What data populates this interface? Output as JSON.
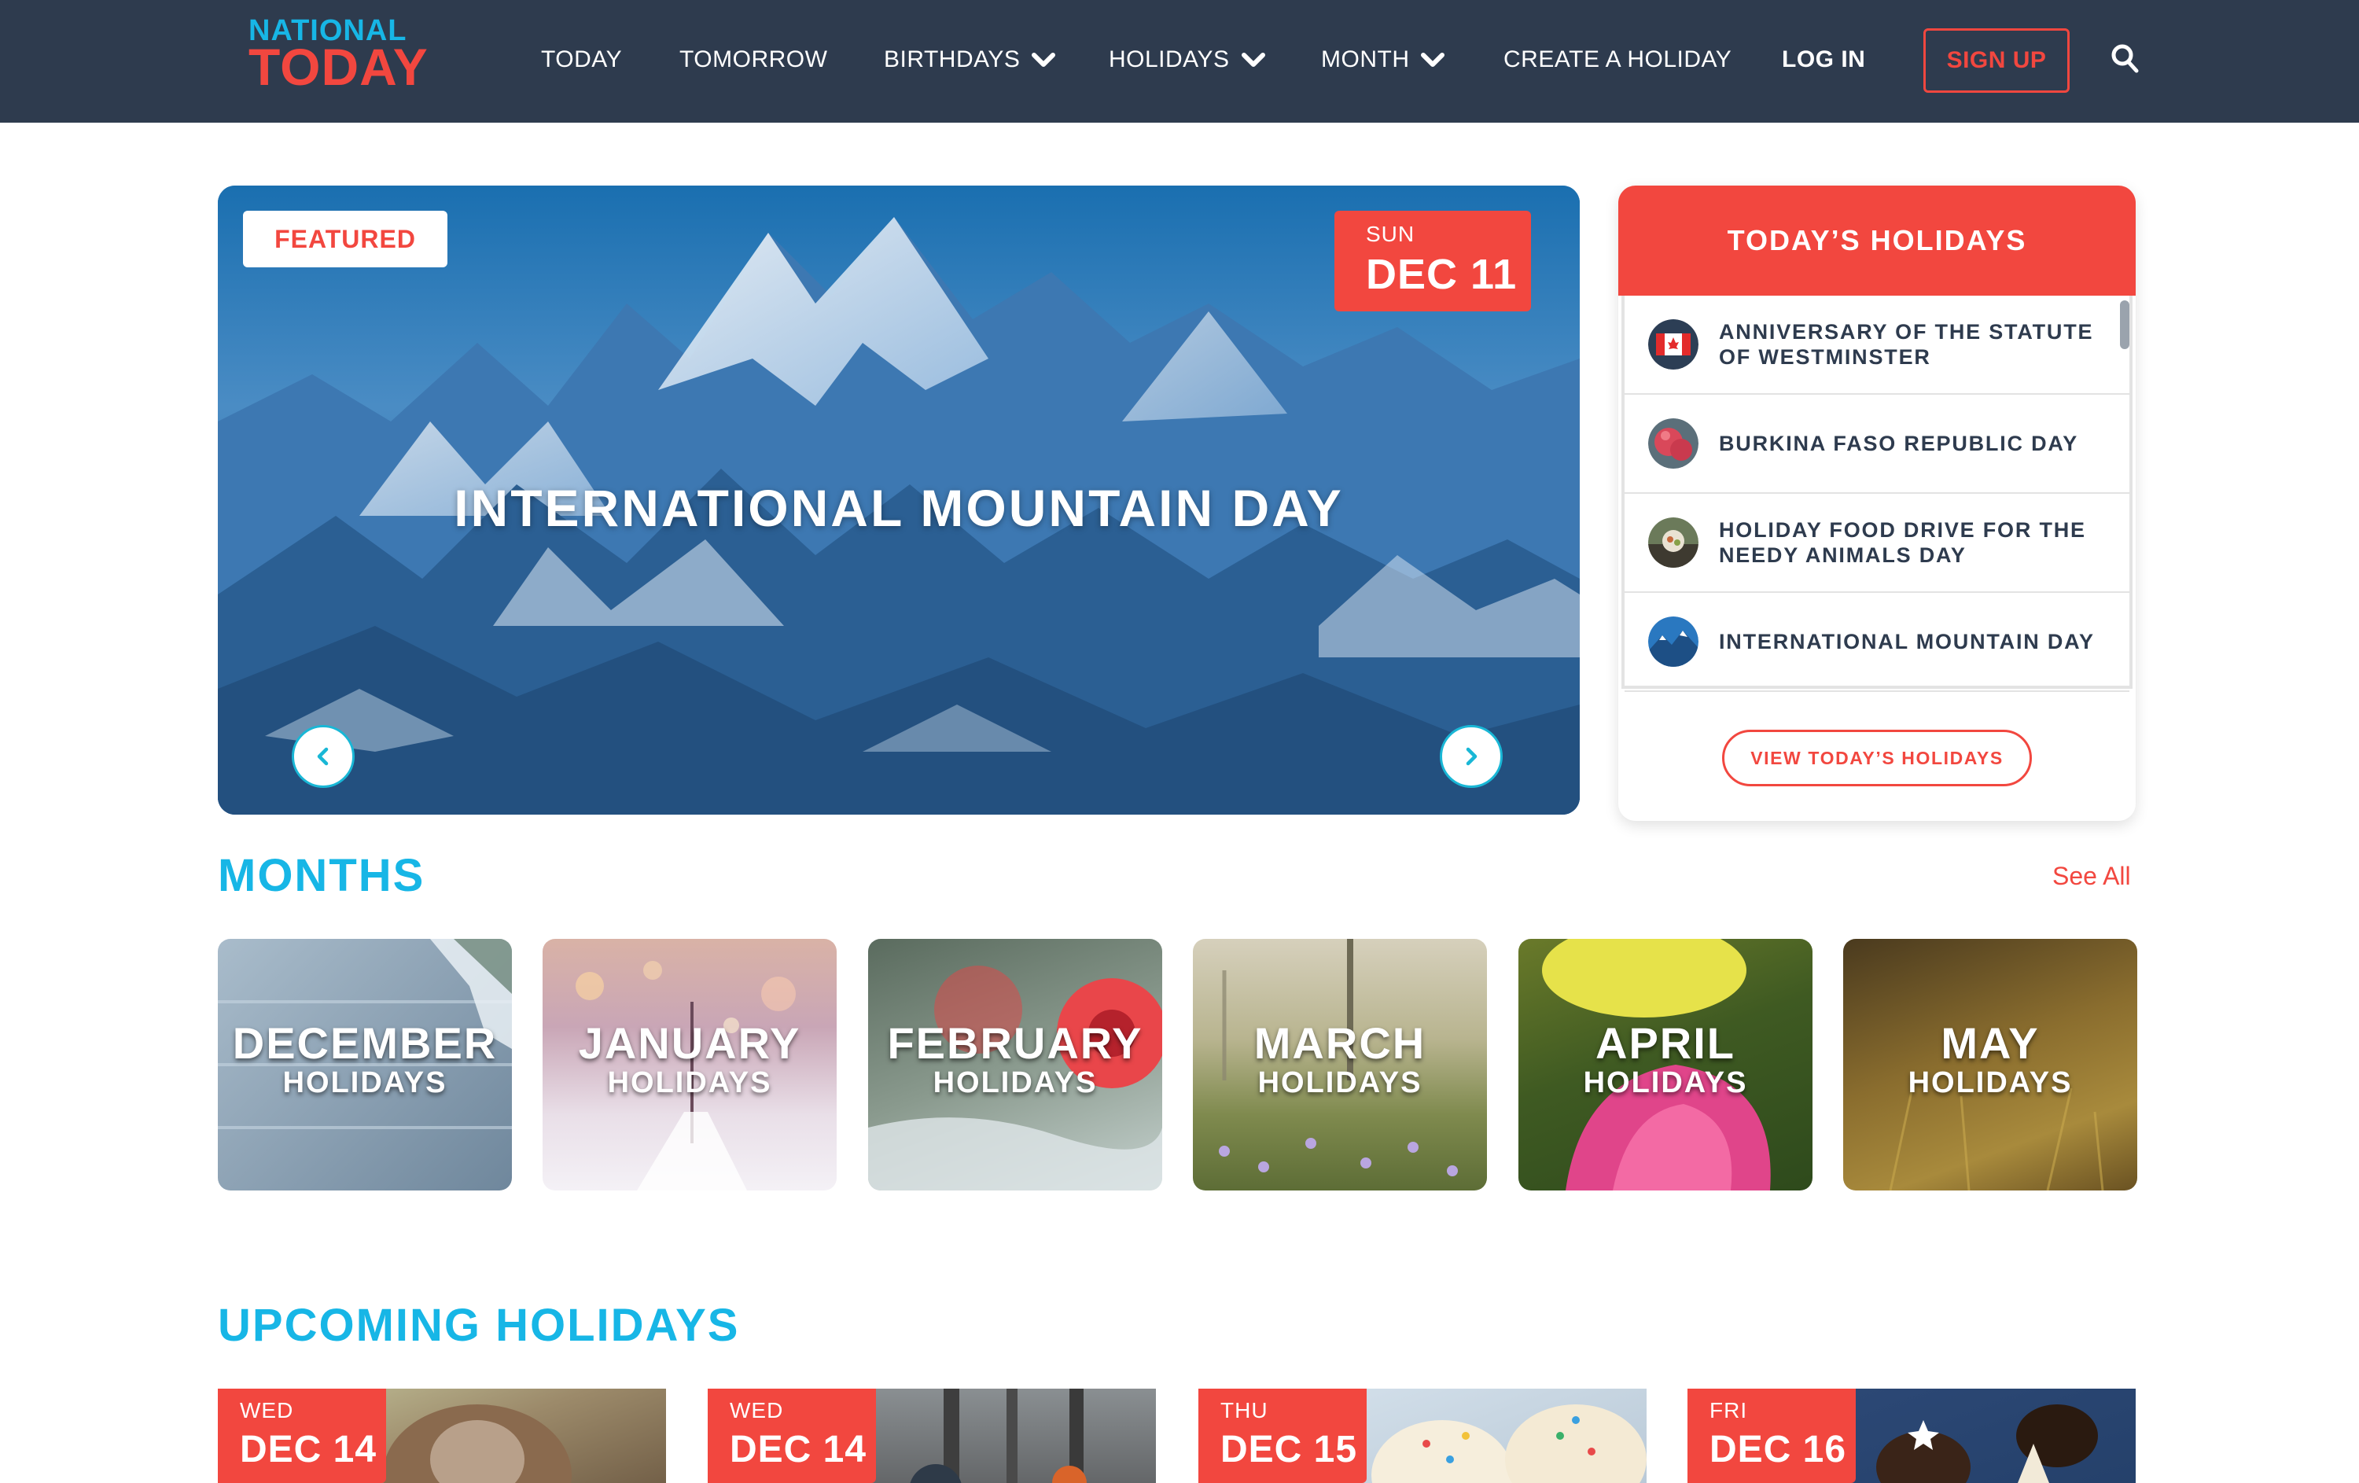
{
  "brand": {
    "line1": "NATIONAL",
    "line2": "TODAY"
  },
  "nav": {
    "items": [
      {
        "label": "TODAY"
      },
      {
        "label": "TOMORROW"
      },
      {
        "label": "BIRTHDAYS"
      },
      {
        "label": "HOLIDAYS"
      },
      {
        "label": "MONTH"
      },
      {
        "label": "CREATE A HOLIDAY"
      },
      {
        "label": "LOG IN"
      }
    ],
    "signup": "SIGN UP"
  },
  "hero": {
    "badge": "FEATURED",
    "day_of_week": "SUN",
    "date": "DEC 11",
    "title": "INTERNATIONAL MOUNTAIN DAY"
  },
  "today": {
    "heading": "TODAY’S HOLIDAYS",
    "items": [
      {
        "label": "ANNIVERSARY OF THE STATUTE OF WESTMINSTER"
      },
      {
        "label": "BURKINA FASO REPUBLIC DAY"
      },
      {
        "label": "HOLIDAY FOOD DRIVE FOR THE NEEDY ANIMALS DAY"
      },
      {
        "label": "INTERNATIONAL MOUNTAIN DAY"
      }
    ],
    "button": "VIEW TODAY’S HOLIDAYS"
  },
  "months": {
    "title": "MONTHS",
    "see_all": "See All",
    "cards": [
      {
        "name": "DECEMBER",
        "sub": "HOLIDAYS"
      },
      {
        "name": "JANUARY",
        "sub": "HOLIDAYS"
      },
      {
        "name": "FEBRUARY",
        "sub": "HOLIDAYS"
      },
      {
        "name": "MARCH",
        "sub": "HOLIDAYS"
      },
      {
        "name": "APRIL",
        "sub": "HOLIDAYS"
      },
      {
        "name": "MAY",
        "sub": "HOLIDAYS"
      }
    ]
  },
  "upcoming": {
    "title": "UPCOMING HOLIDAYS",
    "cards": [
      {
        "dow": "WED",
        "date": "DEC 14"
      },
      {
        "dow": "WED",
        "date": "DEC 14"
      },
      {
        "dow": "THU",
        "date": "DEC 15"
      },
      {
        "dow": "FRI",
        "date": "DEC 16"
      }
    ]
  },
  "colors": {
    "nav_bg": "#2e3b4e",
    "accent_red": "#f2473f",
    "accent_blue": "#17b6e6"
  }
}
